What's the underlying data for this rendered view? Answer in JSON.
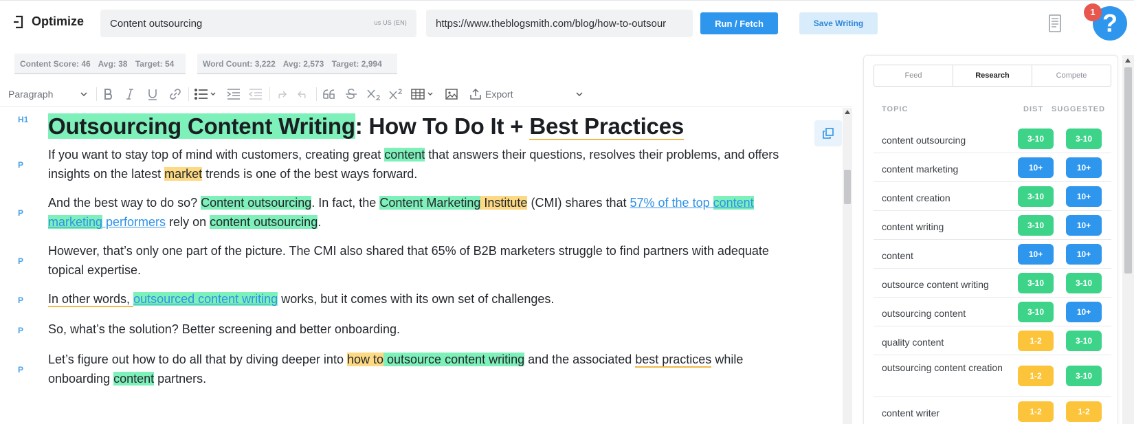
{
  "app": {
    "title": "Optimize"
  },
  "search": {
    "keyword": "Content outsourcing",
    "locale": "us  US (EN)",
    "url": "https://www.theblogsmith.com/blog/how-to-outsour"
  },
  "actions": {
    "run_label": "Run / Fetch",
    "save_label": "Save Writing"
  },
  "help": {
    "badge": "1",
    "label": "?"
  },
  "stats": {
    "score": {
      "label": "Content Score: 46",
      "avg": "Avg: 38",
      "target": "Target: 54"
    },
    "words": {
      "label": "Word Count: 3,222",
      "avg": "Avg: 2,573",
      "target": "Target: 2,994"
    }
  },
  "toolbar": {
    "block_format": "Paragraph",
    "export_label": "Export"
  },
  "document": {
    "tags": [
      "H1",
      "P",
      "P",
      "P",
      "P",
      "P",
      "P"
    ],
    "h1": {
      "part1": "Outsourcing Content Writing",
      "part2": ": How To Do It + ",
      "part3": "Best Practices"
    },
    "p1": {
      "a": "If you want to stay top of mind with customers, creating great ",
      "b": "content",
      "c": " that answers their questions, resolves their problems, and offers insights on the latest ",
      "d": "market",
      "e": " trends is one of the best ways forward."
    },
    "p2": {
      "a": "And the best way to do so? ",
      "b": "Content outsourcing",
      "c": ". In fact, the ",
      "d": "Content Marketing",
      "e": " Institute",
      "f": " (CMI) shares that ",
      "g": "57% of the top ",
      "h": "content marketing",
      "i": " performers",
      "j": " rely on ",
      "k": "content outsourcing",
      "l": "."
    },
    "p3": "However, that’s only one part of the picture. The CMI also shared that 65% of B2B marketers struggle to find partners with adequate topical expertise.",
    "p4": {
      "a": "In other words, ",
      "b": "outsourced content writing",
      "c": " works, but it comes with its own set of challenges."
    },
    "p5": "So, what’s the solution? Better screening and better onboarding.",
    "p6": {
      "a": "Let’s figure out how to do all that by diving deeper into ",
      "b": "how to",
      "c": " ",
      "d": "outsource content writing",
      "e": " and the associated ",
      "f": "best practices",
      "g": " while onboarding ",
      "h": "content",
      "i": " partners."
    }
  },
  "panel": {
    "tabs": [
      "Feed",
      "Research",
      "Compete"
    ],
    "active_tab": "Research",
    "headers": {
      "topic": "TOPIC",
      "dist": "DIST",
      "suggested": "SUGGESTED"
    },
    "colors": {
      "green": "#3dd489",
      "blue": "#2f96ee",
      "yellow": "#fcc43a"
    },
    "topics": [
      {
        "name": "content outsourcing",
        "dist": "3-10",
        "dist_color": "green",
        "suggested": "3-10",
        "suggested_color": "green"
      },
      {
        "name": "content marketing",
        "dist": "10+",
        "dist_color": "blue",
        "suggested": "10+",
        "suggested_color": "blue"
      },
      {
        "name": "content creation",
        "dist": "3-10",
        "dist_color": "green",
        "suggested": "10+",
        "suggested_color": "blue"
      },
      {
        "name": "content writing",
        "dist": "3-10",
        "dist_color": "green",
        "suggested": "10+",
        "suggested_color": "blue"
      },
      {
        "name": "content",
        "dist": "10+",
        "dist_color": "blue",
        "suggested": "10+",
        "suggested_color": "blue"
      },
      {
        "name": "outsource content writing",
        "dist": "3-10",
        "dist_color": "green",
        "suggested": "3-10",
        "suggested_color": "green"
      },
      {
        "name": "outsourcing content",
        "dist": "3-10",
        "dist_color": "green",
        "suggested": "10+",
        "suggested_color": "blue"
      },
      {
        "name": "quality content",
        "dist": "1-2",
        "dist_color": "yellow",
        "suggested": "3-10",
        "suggested_color": "green"
      },
      {
        "name": "outsourcing content creation",
        "dist": "1-2",
        "dist_color": "yellow",
        "suggested": "3-10",
        "suggested_color": "green"
      },
      {
        "name": "content writer",
        "dist": "1-2",
        "dist_color": "yellow",
        "suggested": "1-2",
        "suggested_color": "yellow"
      }
    ]
  }
}
